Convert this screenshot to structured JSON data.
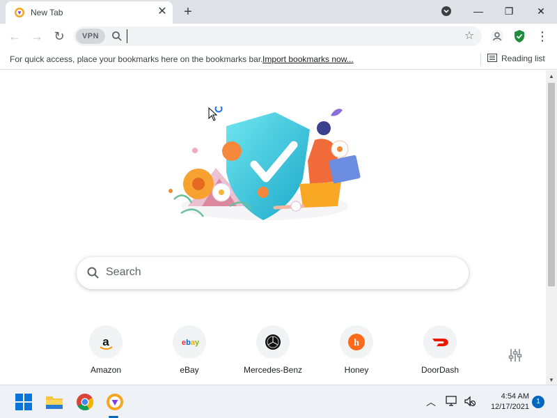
{
  "tab": {
    "title": "New Tab",
    "close_glyph": "✕"
  },
  "window": {
    "new_tab_glyph": "+",
    "minimize_glyph": "—",
    "restore_glyph": "❐",
    "close_glyph": "✕"
  },
  "toolbar": {
    "back_glyph": "←",
    "forward_glyph": "→",
    "reload_glyph": "↻",
    "vpn_label": "VPN",
    "address_value": "",
    "star_glyph": "☆",
    "menu_glyph": "⋮"
  },
  "bookmarks": {
    "hint": "For quick access, place your bookmarks here on the bookmarks bar.",
    "import_link": "Import bookmarks now...",
    "reading_list": "Reading list"
  },
  "ntp": {
    "search_placeholder": "Search",
    "tiles": [
      {
        "label": "Amazon",
        "icon": "amazon-icon"
      },
      {
        "label": "eBay",
        "icon": "ebay-icon"
      },
      {
        "label": "Mercedes-Benz",
        "icon": "mercedes-benz-icon"
      },
      {
        "label": "Honey",
        "icon": "honey-icon"
      },
      {
        "label": "DoorDash",
        "icon": "doordash-icon"
      }
    ]
  },
  "taskbar": {
    "time": "4:54 AM",
    "date": "12/17/2021",
    "notification_count": "1"
  },
  "colors": {
    "accent": "#0067c0",
    "shield": "#2ec4d6",
    "flower": "#f59b2f",
    "brand_orange": "#f7a823"
  }
}
